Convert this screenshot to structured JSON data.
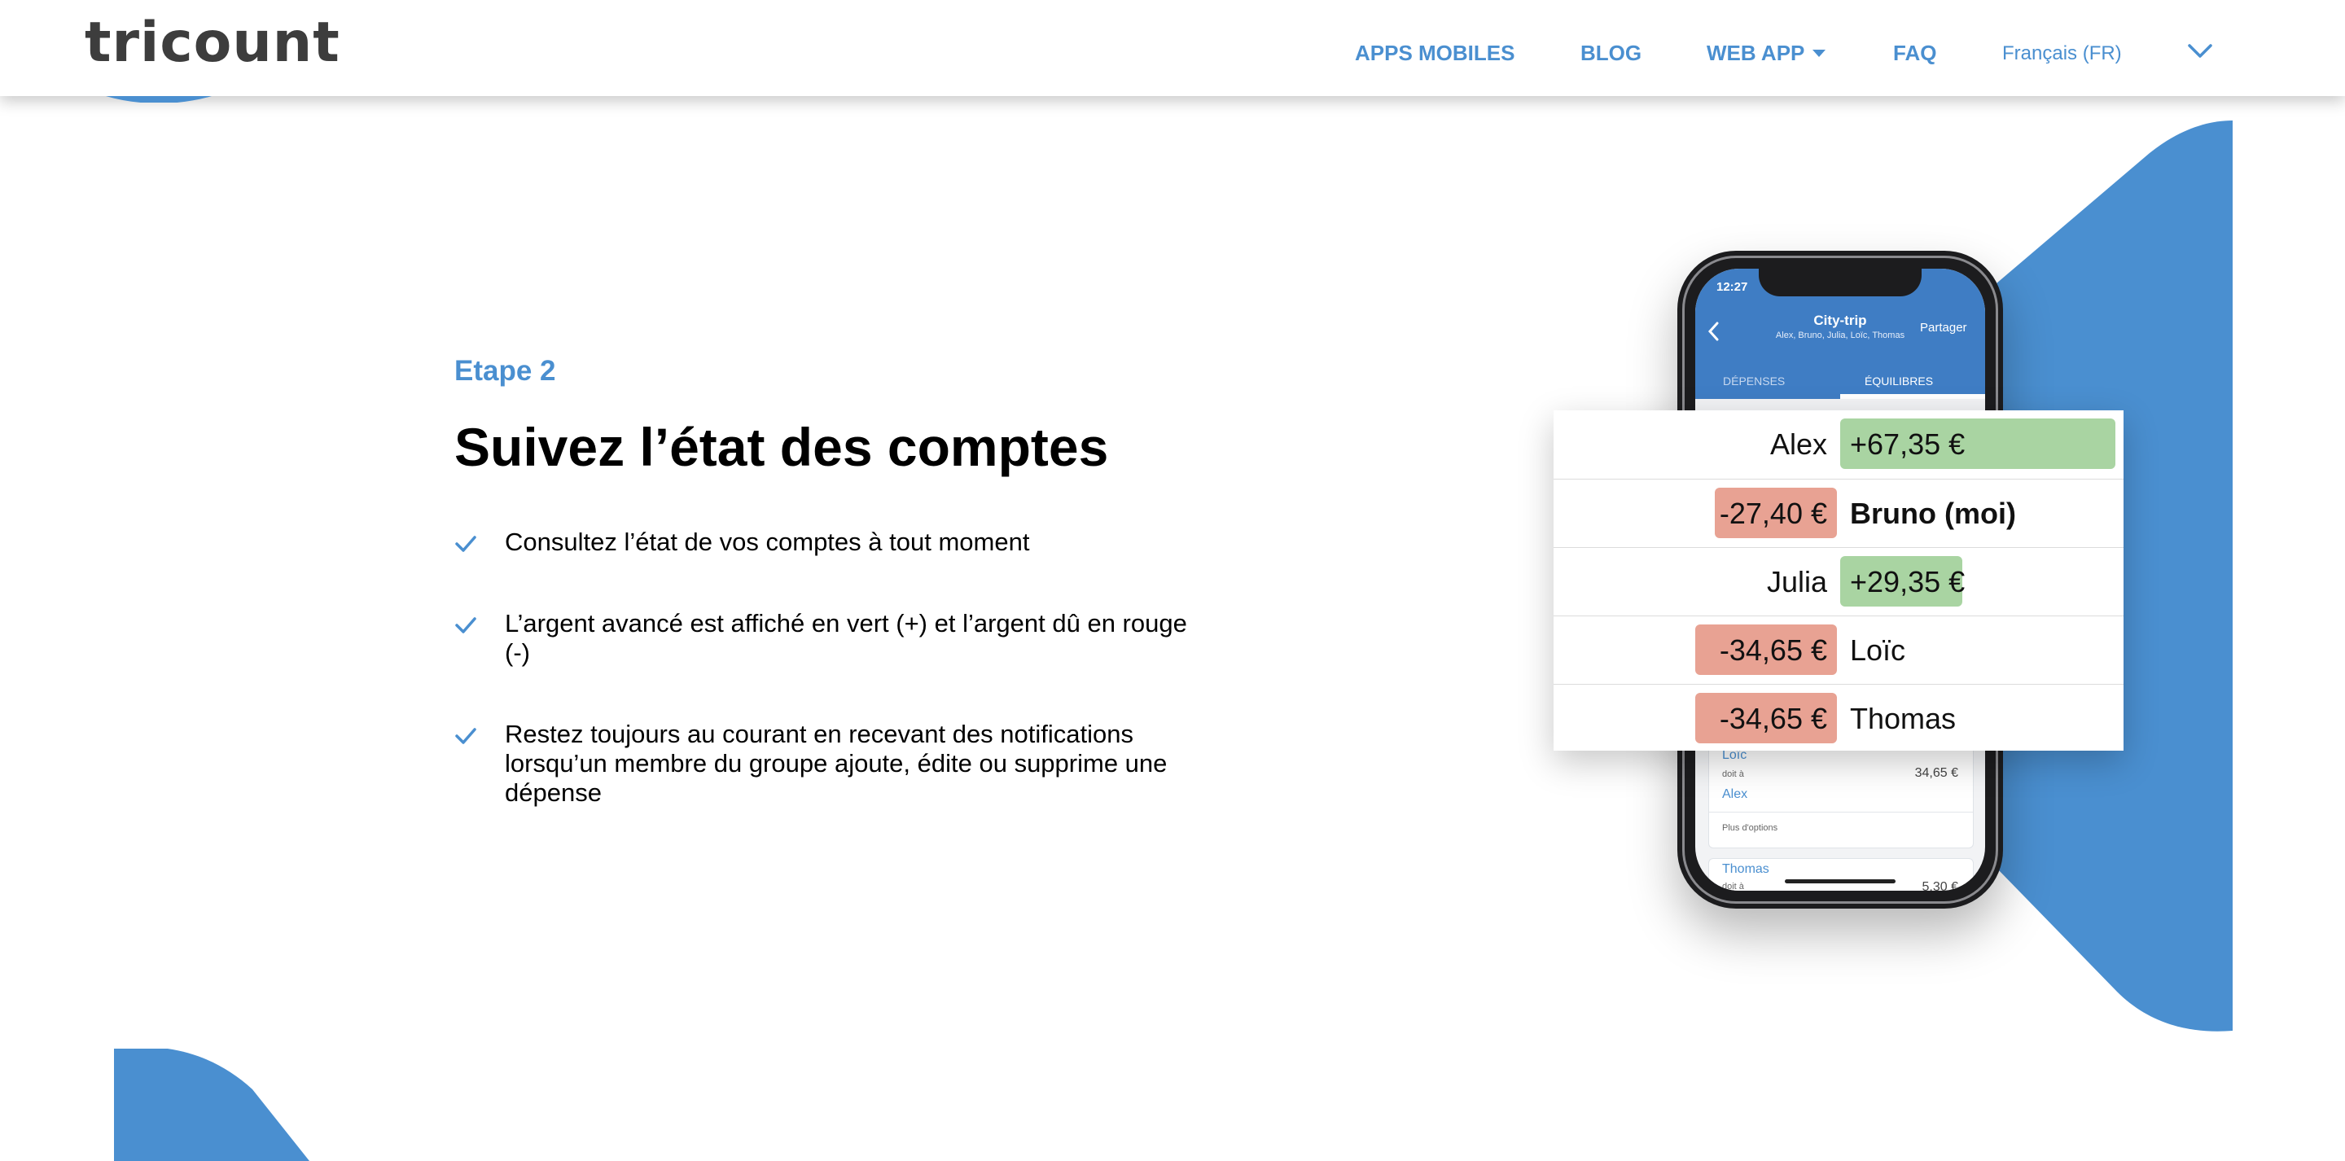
{
  "header": {
    "logo": "tricount",
    "nav": {
      "apps": "APPS MOBILES",
      "blog": "BLOG",
      "webapp": "WEB APP",
      "faq": "FAQ",
      "language": "Français (FR)"
    }
  },
  "colors": {
    "accent": "#4a8fd0",
    "positive": "#a9d4a2",
    "negative": "#e8a293"
  },
  "main": {
    "step": "Etape 2",
    "title": "Suivez l’état des comptes",
    "bullets": [
      "Consultez l’état de vos comptes à tout moment",
      "L’argent avancé est affiché en vert (+) et l’argent dû en rouge (-)",
      "Restez toujours au courant en recevant des notifications lorsqu’un membre du groupe ajoute, édite ou supprime une dépense"
    ]
  },
  "phone": {
    "time": "12:27",
    "title": "City-trip",
    "subtitle": "Alex, Bruno, Julia, Loïc, Thomas",
    "share": "Partager",
    "tab_expenses": "DÉPENSES",
    "tab_balances": "ÉQUILIBRES",
    "card1": {
      "from": "Loïc",
      "owes": "doit à",
      "to": "Alex",
      "amount": "34,65 €",
      "more": "Plus d'options"
    },
    "card2": {
      "from": "Thomas",
      "owes": "doit à",
      "amount": "5,30 €"
    }
  },
  "balances": [
    {
      "name": "Alex",
      "amount": "+67,35 €",
      "sign": "pos",
      "value": 67.35
    },
    {
      "name": "Bruno (moi)",
      "amount": "-27,40 €",
      "sign": "neg",
      "value": -27.4
    },
    {
      "name": "Julia",
      "amount": "+29,35 €",
      "sign": "pos",
      "value": 29.35
    },
    {
      "name": "Loïc",
      "amount": "-34,65 €",
      "sign": "neg",
      "value": -34.65
    },
    {
      "name": "Thomas",
      "amount": "-34,65 €",
      "sign": "neg",
      "value": -34.65
    }
  ]
}
